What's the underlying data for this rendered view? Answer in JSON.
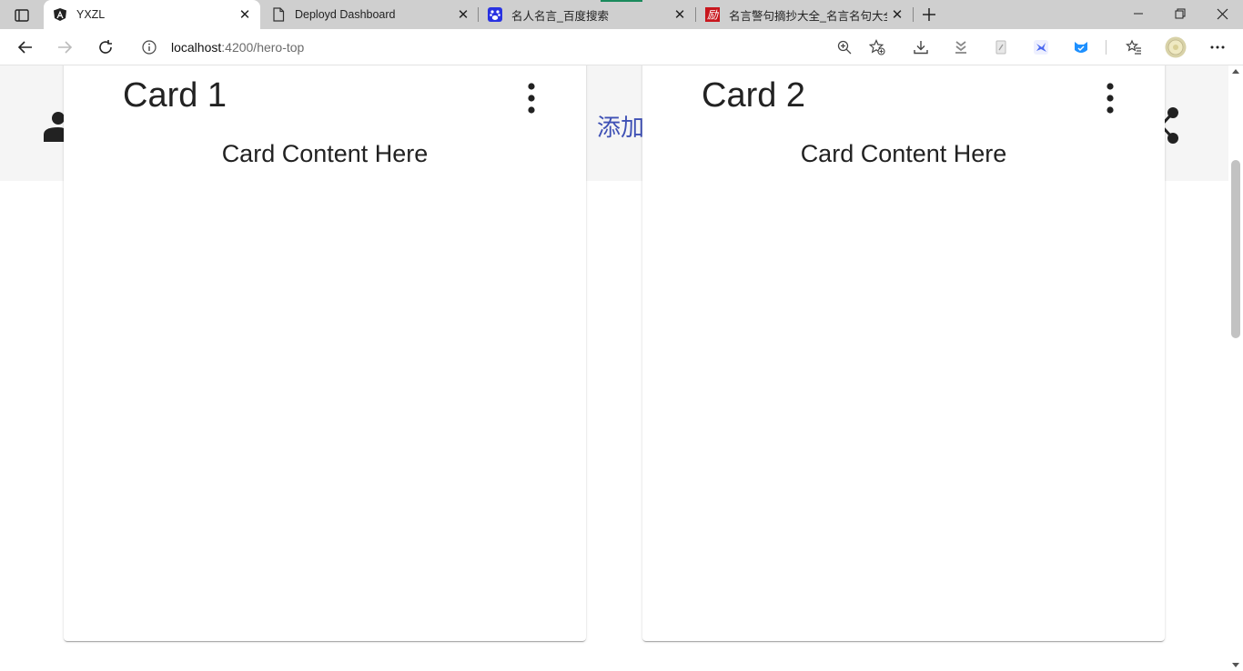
{
  "browser": {
    "tabs": [
      {
        "title": "YXZL",
        "icon": "angular-icon",
        "active": true
      },
      {
        "title": "Deployd Dashboard",
        "icon": "page-icon",
        "active": false
      },
      {
        "title": "名人名言_百度搜索",
        "icon": "baidu-icon",
        "active": false
      },
      {
        "title": "名言警句摘抄大全_名言名句大全",
        "icon": "li-icon",
        "active": false
      }
    ],
    "url_host": "localhost",
    "url_path": ":4200/hero-top"
  },
  "page": {
    "band_link": "添加",
    "cards": [
      {
        "title": "Card 1",
        "content": "Card Content Here"
      },
      {
        "title": "Card 2",
        "content": "Card Content Here"
      }
    ]
  },
  "colors": {
    "accent": "#3f51b5",
    "tabstrip": "#cfcfcf",
    "hero_band": "#f5f5f5"
  }
}
